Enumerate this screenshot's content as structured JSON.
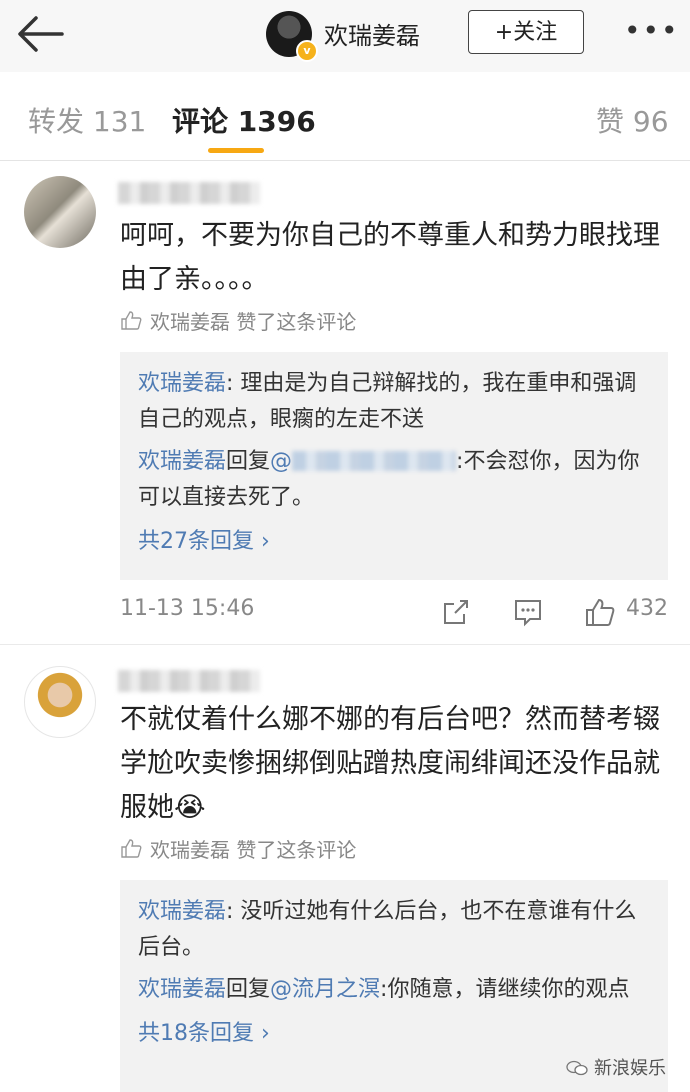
{
  "header": {
    "user_name": "欢瑞姜磊",
    "follow_label": "+关注"
  },
  "tabs": {
    "repost": "转发 131",
    "comment": "评论 1396",
    "like": "赞 96"
  },
  "comments": [
    {
      "text": "呵呵，不要为你自己的不尊重人和势力眼找理由了亲。。。。",
      "liked_by": "欢瑞姜磊 赞了这条评论",
      "replies": [
        {
          "author": "欢瑞姜磊",
          "sep": ": ",
          "text": "理由是为自己辩解找的，我在重申和强调自己的观点，眼瘸的左走不送"
        },
        {
          "author": "欢瑞姜磊",
          "reply_word": "回复",
          "mention": "@",
          "sep": ":",
          "text": "不会怼你，因为你可以直接去死了。"
        }
      ],
      "more_replies": "共27条回复 ›",
      "time": "11-13 15:46",
      "likes": "432"
    },
    {
      "text": "不就仗着什么娜不娜的有后台吧？然而替考辍学尬吹卖惨捆绑倒贴蹭热度闹绯闻还没作品就服她😭",
      "liked_by": "欢瑞姜磊 赞了这条评论",
      "replies": [
        {
          "author": "欢瑞姜磊",
          "sep": ": ",
          "text": "没听过她有什么后台，也不在意谁有什么后台。"
        },
        {
          "author": "欢瑞姜磊",
          "reply_word": "回复",
          "mention": "@流月之溟",
          "sep": ":",
          "text": "你随意，请继续你的观点"
        }
      ],
      "more_replies": "共18条回复 ›"
    }
  ],
  "watermark": "新浪娱乐",
  "colors": {
    "accent": "#f7a813",
    "link": "#4f7bb3"
  }
}
